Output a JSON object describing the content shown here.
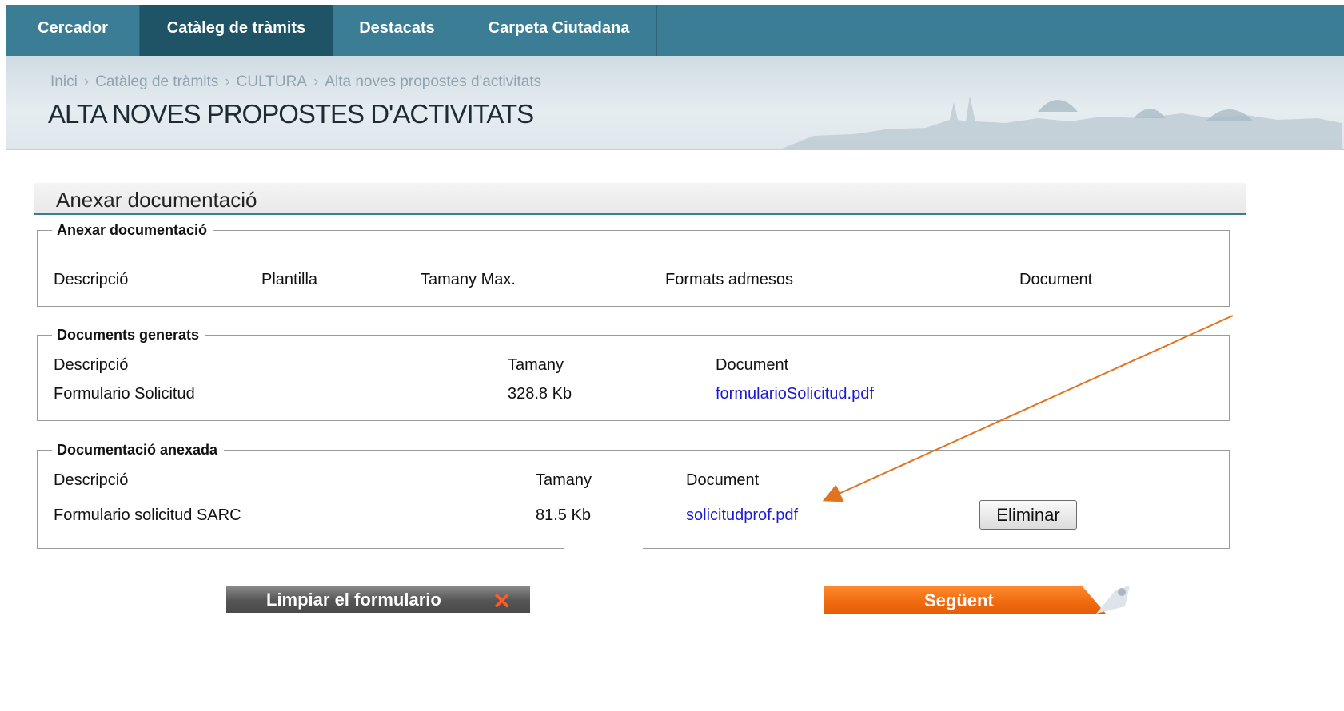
{
  "nav": {
    "tabs": [
      {
        "label": "Cercador"
      },
      {
        "label": "Catàleg de tràmits",
        "active": true
      },
      {
        "label": "Destacats"
      },
      {
        "label": "Carpeta Ciutadana"
      }
    ]
  },
  "breadcrumb": [
    "Inici",
    "Catàleg de tràmits",
    "CULTURA",
    "Alta noves propostes d'activitats"
  ],
  "breadcrumb_separator": "›",
  "page_title": "ALTA NOVES PROPOSTES D'ACTIVITATS",
  "section_title": "Anexar documentació",
  "anexar": {
    "legend": "Anexar documentació",
    "headers": {
      "descripcio": "Descripció",
      "plantilla": "Plantilla",
      "tamany_max": "Tamany Max.",
      "formats": "Formats admesos",
      "document": "Document"
    }
  },
  "generats": {
    "legend": "Documents generats",
    "headers": {
      "descripcio": "Descripció",
      "tamany": "Tamany",
      "document": "Document"
    },
    "rows": [
      {
        "descripcio": "Formulario Solicitud",
        "tamany": "328.8 Kb",
        "document": "formularioSolicitud.pdf"
      }
    ]
  },
  "anexada": {
    "legend": "Documentació anexada",
    "headers": {
      "descripcio": "Descripció",
      "tamany": "Tamany",
      "document": "Document"
    },
    "rows": [
      {
        "descripcio": "Formulario solicitud SARC",
        "tamany": "81.5 Kb",
        "document": "solicitudprof.pdf",
        "action": "Eliminar"
      }
    ]
  },
  "buttons": {
    "limpiar": "Limpiar el formulario",
    "seguent": "Següent"
  },
  "colors": {
    "nav": "#3a7d95",
    "nav_active": "#1f5366",
    "link": "#1b1bd6",
    "next_button": "#f06a0f",
    "annotation_arrow": "#e0731f"
  },
  "icons": [
    "close-x-icon",
    "skyline-decoration",
    "page-curl-icon",
    "annotation-arrow"
  ]
}
